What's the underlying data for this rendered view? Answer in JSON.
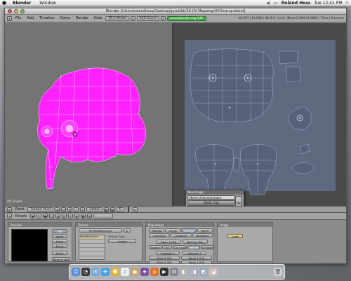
{
  "menubar": {
    "apple": "",
    "app_name": "Blender",
    "menu": "Window",
    "user": "Roland Hess",
    "clock": "Tue 12:41 PM",
    "icons": [
      "apple-icon",
      "spotlight-icon",
      "volume-icon",
      "battery-icon"
    ]
  },
  "window": {
    "title": "Blender [/Users/rolandhess/Desktop/gurck/bk/16 UV Mapping/UVUnwrap.blend]"
  },
  "info_header": {
    "menus": [
      "File",
      "Add",
      "Timeline",
      "Game",
      "Render",
      "Help"
    ],
    "screen": "SR:2-Model",
    "scene": "SCE:Scene",
    "url": "www.blender.org 242",
    "stats": "Ve:507 | Fa:500 | Ob:0-0 | La:0 | Mem:5.24M (0.00M) | Time | Suzanne"
  },
  "view3d": {
    "scene_label": "(0) Scene"
  },
  "header_3d": {
    "mode": "Paint",
    "paint_mode": "Texture Paint",
    "orientation": "Global",
    "layer": "6"
  },
  "popup": {
    "title": "New Image",
    "name": "Name:Untexeigerpaint",
    "width": "Width: 512",
    "height": "Height: 512",
    "grid": "UV Test Grid",
    "ok": "OK"
  },
  "panel_bar": {
    "label": "Panels",
    "tabs": [
      "",
      "",
      "",
      "",
      "",
      ""
    ]
  },
  "panels": {
    "preview": {
      "title": "Preview",
      "buttons": [
        "Mat",
        "World",
        "Lamp",
        "Brush",
        "Alpha",
        "Default Vars"
      ]
    },
    "texture": {
      "title": "Texture",
      "name": "TE:PartsStructure",
      "slot_label": "PartsStructure",
      "type_label": "Texture Type",
      "type_value": "Image"
    },
    "map_image": {
      "title": "Map Image",
      "row1": [
        "MipMap",
        "Gauss",
        "Interpol",
        "Rot90"
      ],
      "row2": [
        "UseAlpha",
        "CalcAlpha",
        "NegAlpha"
      ],
      "filter": "Filter: 1.000",
      "normal_map": "Normal Map",
      "row3": [
        "Extend",
        "Clip",
        "Clip Cube",
        "Repeat",
        "Checker"
      ],
      "xrepeat": "Xrepeat: 1",
      "yrepeat": "Yrepeat: 1",
      "minx": "MinX 0.000",
      "maxx": "MaxX 1.000",
      "miny": "MinY 0.000",
      "maxy": "MaxY 1.000"
    },
    "image": {
      "title": "Image",
      "load": "Load"
    }
  },
  "dock_icons": [
    "finder",
    "dashboard",
    "mail",
    "safari",
    "ichat",
    "itunes",
    "iphoto",
    "imovie",
    "blender",
    "terminal",
    "preferences",
    "misc",
    "trash"
  ]
}
